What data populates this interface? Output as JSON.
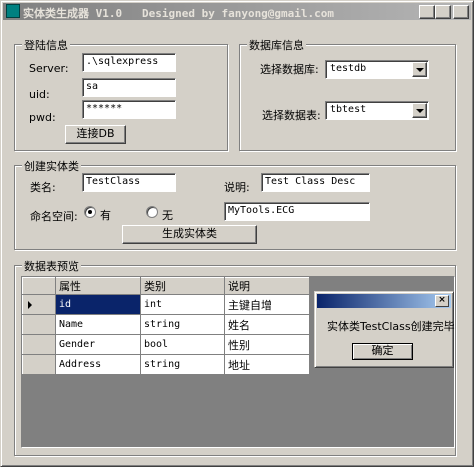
{
  "window": {
    "title": "实体类生成器 V1.0   Designed by fanyong@gmail.com",
    "minimize": "_",
    "maximize": "□",
    "close": "×"
  },
  "login": {
    "legend": "登陆信息",
    "server_label": "Server:",
    "server_value": ".\\sqlexpress",
    "uid_label": "uid:",
    "uid_value": "sa",
    "pwd_label": "pwd:",
    "pwd_value": "******",
    "connect_button": "连接DB"
  },
  "database": {
    "legend": "数据库信息",
    "db_label": "选择数据库:",
    "db_value": "testdb",
    "table_label": "选择数据表:",
    "table_value": "tbtest"
  },
  "entity": {
    "legend": "创建实体类",
    "class_label": "类名:",
    "class_value": "TestClass",
    "desc_label": "说明:",
    "desc_value": "Test Class Desc",
    "ns_label": "命名空间:",
    "ns_yes": "有",
    "ns_no": "无",
    "ns_selected": "有",
    "ns_value": "MyTools.ECG",
    "generate_button": "生成实体类"
  },
  "preview": {
    "legend": "数据表预览",
    "columns": [
      "属性",
      "类别",
      "说明"
    ],
    "rows": [
      [
        "id",
        "int",
        "主键自增"
      ],
      [
        "Name",
        "string",
        "姓名"
      ],
      [
        "Gender",
        "bool",
        "性别"
      ],
      [
        "Address",
        "string",
        "地址"
      ]
    ]
  },
  "dialog": {
    "message": "实体类TestClass创建完毕",
    "ok_button": "确定",
    "close": "×"
  }
}
